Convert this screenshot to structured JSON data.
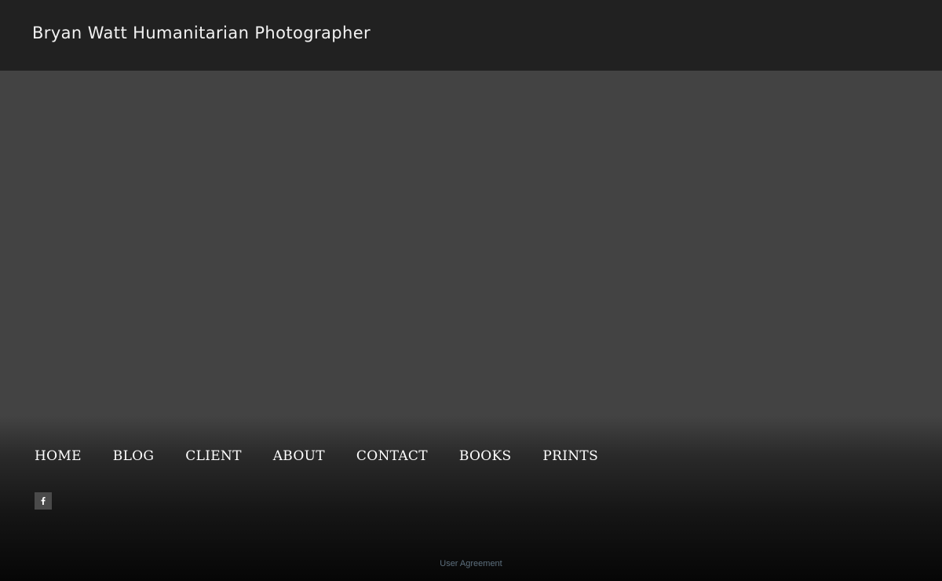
{
  "header": {
    "site_title": "Bryan Watt Humanitarian Photographer"
  },
  "nav": {
    "items": [
      {
        "label": "HOME"
      },
      {
        "label": "BLOG"
      },
      {
        "label": "CLIENT"
      },
      {
        "label": "ABOUT"
      },
      {
        "label": "CONTACT"
      },
      {
        "label": "BOOKS"
      },
      {
        "label": "PRINTS"
      }
    ]
  },
  "social": {
    "icons": [
      {
        "icon": "facebook-icon"
      }
    ]
  },
  "footer": {
    "user_agreement": "User Agreement"
  },
  "colors": {
    "header_bg": "#212121",
    "hero_bg": "#434343",
    "link_muted": "#5d6f7d"
  }
}
